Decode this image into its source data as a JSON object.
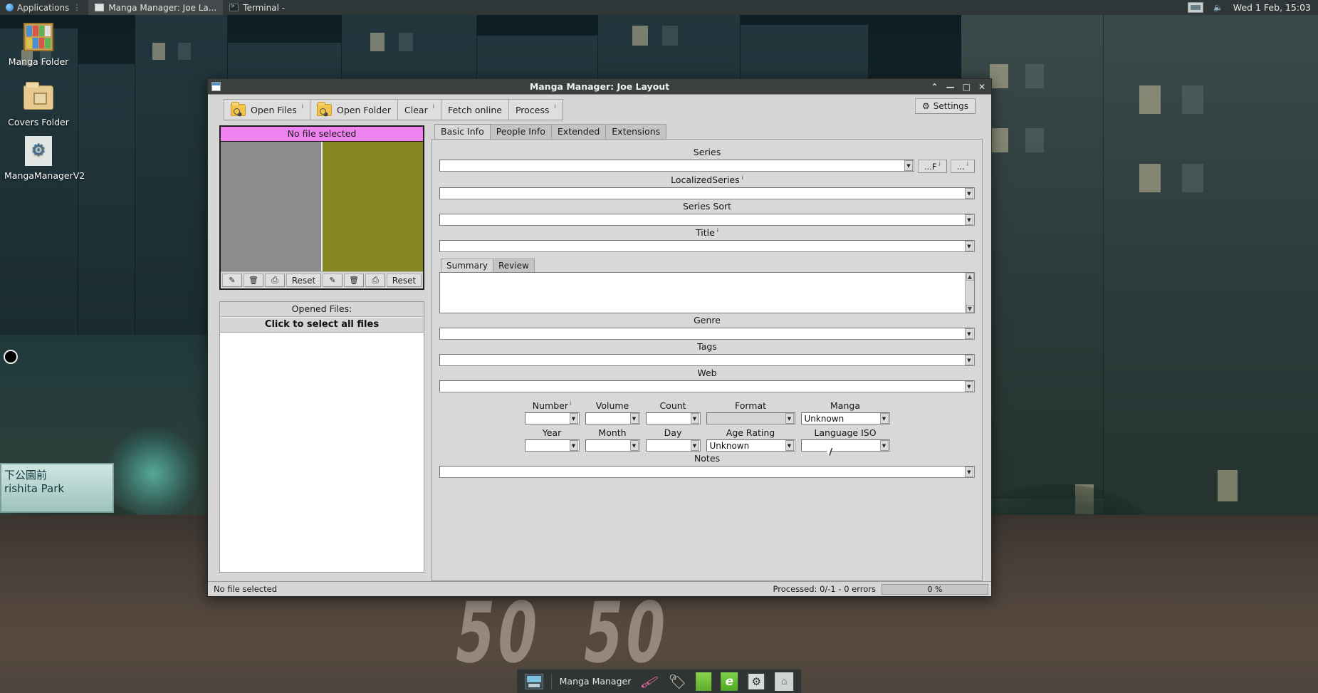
{
  "top_panel": {
    "applications_label": "Applications",
    "tasks": [
      {
        "label": "Manga Manager: Joe La...",
        "icon": "window-icon",
        "active": true
      },
      {
        "label": "Terminal -",
        "icon": "terminal-icon",
        "active": false
      }
    ],
    "clock": "Wed 1 Feb, 15:03",
    "volume_icon": "speaker-icon",
    "workspace_icon": "workspace-switcher-icon"
  },
  "desktop_icons": [
    {
      "label": "Manga Folder",
      "icon": "bookshelf-icon"
    },
    {
      "label": "Covers Folder",
      "icon": "folder-image-icon"
    },
    {
      "label": "MangaManagerV2",
      "icon": "gear-app-icon"
    }
  ],
  "wallpaper": {
    "street_sign_line1": "下公園前",
    "street_sign_line2": "rishita Park",
    "road_marking_left": "50",
    "road_marking_right": "50"
  },
  "dock": {
    "window_label": "Manga Manager",
    "items": [
      {
        "name": "window-preview-icon"
      },
      {
        "name": "eyedropper-icon"
      },
      {
        "name": "tag-icon"
      },
      {
        "name": "green-app-icon"
      },
      {
        "name": "evernote-icon"
      },
      {
        "name": "gear-icon"
      },
      {
        "name": "home-folder-icon"
      }
    ]
  },
  "window": {
    "title": "Manga Manager: Joe Layout",
    "controls": {
      "shade": "⌃",
      "minimize": "—",
      "maximize": "□",
      "close": "✕"
    }
  },
  "toolbar": {
    "buttons": [
      {
        "label": "Open Files",
        "icon": "open-files-icon",
        "sup": "i"
      },
      {
        "label": "Open Folder",
        "icon": "open-folder-icon",
        "sup": ""
      },
      {
        "label": "Clear",
        "icon": "",
        "sup": "i"
      },
      {
        "label": "Fetch online",
        "icon": "",
        "sup": ""
      },
      {
        "label": "Process",
        "icon": "",
        "sup": "i"
      }
    ],
    "settings_label": "Settings",
    "settings_icon": "gear-icon"
  },
  "cover_panel": {
    "header": "No file selected",
    "color_left": "#8c8c8c",
    "color_right": "#87851f",
    "buttons_left": [
      {
        "name": "edit-cover-button",
        "icon": "pencil-icon",
        "label": "✎"
      },
      {
        "name": "delete-cover-button",
        "icon": "trash-icon",
        "label": "Ὕ1"
      },
      {
        "name": "copy-cover-button",
        "icon": "document-icon",
        "label": "⎕"
      },
      {
        "name": "reset-cover-button",
        "icon": "",
        "label": "Reset"
      }
    ],
    "buttons_right": [
      {
        "name": "edit-backcover-button",
        "icon": "pencil-icon",
        "label": "✎"
      },
      {
        "name": "delete-backcover-button",
        "icon": "trash-icon",
        "label": "Ὕ1"
      },
      {
        "name": "copy-backcover-button",
        "icon": "document-icon",
        "label": "⎕"
      },
      {
        "name": "reset-backcover-button",
        "icon": "",
        "label": "Reset"
      }
    ]
  },
  "opened_files": {
    "title": "Opened Files:",
    "select_all": "Click to select all files",
    "items": []
  },
  "tabs": [
    {
      "label": "Basic Info",
      "active": true
    },
    {
      "label": "People Info",
      "active": false
    },
    {
      "label": "Extended",
      "active": false
    },
    {
      "label": "Extensions",
      "active": false
    }
  ],
  "basic_info": {
    "series": {
      "label": "Series",
      "value": "",
      "sup": ""
    },
    "series_btn1": {
      "label": "...F",
      "sup": "i"
    },
    "series_btn2": {
      "label": "...",
      "sup": "i"
    },
    "localized_series": {
      "label": "LocalizedSeries",
      "value": "",
      "sup": "i"
    },
    "series_sort": {
      "label": "Series Sort",
      "value": "",
      "sup": ""
    },
    "title": {
      "label": "Title",
      "value": "",
      "sup": "i"
    },
    "summary_tabs": [
      {
        "label": "Summary",
        "active": true
      },
      {
        "label": "Review",
        "active": false
      }
    ],
    "summary_text": "",
    "genre": {
      "label": "Genre",
      "value": ""
    },
    "tags": {
      "label": "Tags",
      "value": ""
    },
    "web": {
      "label": "Web",
      "value": ""
    },
    "number": {
      "label": "Number",
      "value": "",
      "sup": "i"
    },
    "volume": {
      "label": "Volume",
      "value": "",
      "sup": ""
    },
    "count": {
      "label": "Count",
      "value": "",
      "sup": ""
    },
    "format": {
      "label": "Format",
      "value": "",
      "sup": ""
    },
    "manga": {
      "label": "Manga",
      "value": "Unknown",
      "sup": ""
    },
    "year": {
      "label": "Year",
      "value": "",
      "sup": ""
    },
    "month": {
      "label": "Month",
      "value": "",
      "sup": ""
    },
    "day": {
      "label": "Day",
      "value": "",
      "sup": ""
    },
    "age_rating": {
      "label": "Age Rating",
      "value": "Unknown",
      "sup": ""
    },
    "language_iso": {
      "label": "Language ISO",
      "value": "",
      "sup": ""
    },
    "notes": {
      "label": "Notes",
      "value": ""
    }
  },
  "statusbar": {
    "left": "No file selected",
    "processed": "Processed: 0/-1 - 0 errors",
    "progress": "0 %"
  }
}
